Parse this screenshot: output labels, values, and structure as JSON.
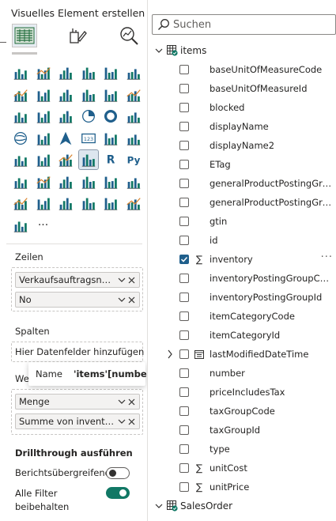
{
  "left_pane": {
    "title": "Visuelles Element erstellen",
    "tabs": [
      {
        "name": "build-visual",
        "icon": "table-grid-icon"
      },
      {
        "name": "format-visual",
        "icon": "paintbrush-icon"
      },
      {
        "name": "analytics",
        "icon": "magnifier-chart-icon"
      }
    ],
    "visual_icons": [
      "stacked-bar-chart",
      "stacked-column-chart",
      "clustered-bar-chart",
      "clustered-column-chart",
      "100-stacked-bar-chart",
      "100-stacked-column-chart",
      "line-chart",
      "area-chart",
      "stacked-area-chart",
      "line-and-column-chart",
      "line-and-clustered-column-chart",
      "ribbon-chart",
      "waterfall-chart",
      "funnel-chart",
      "scatter-chart",
      "pie-chart",
      "donut-chart",
      "treemap",
      "map",
      "filled-map",
      "azure-map",
      "card",
      "multi-row-card",
      "kpi",
      "gauge",
      "slicer",
      "table",
      "matrix",
      "r-script-visual",
      "python-visual",
      "key-influencers",
      "decomposition-tree",
      "qa-visual",
      "smart-narrative",
      "goals",
      "paginated-report",
      "power-apps",
      "power-automate",
      "arcgis-map",
      "shape",
      "chevron",
      "azure-map-layers",
      "text-box",
      "more-visuals"
    ],
    "more_label": "···",
    "zeilen_label": "Zeilen",
    "zeilen_fields": [
      "Verkaufsauftragsnum...",
      "No"
    ],
    "spalten_label": "Spalten",
    "spalten_placeholder": "Hier Datenfelder hinzufügen",
    "werte_label": "We",
    "werte_fields": [
      "Menge",
      "Summe von inventory"
    ],
    "drillthrough_label": "Drillthrough ausführen",
    "cross_report_label": "Berichtsübergreifend",
    "cross_report_on": false,
    "keep_filters_label": "Alle Filter beibehalten",
    "keep_filters_on": true,
    "tooltip": {
      "key": "Name",
      "value": "'items'[number]"
    }
  },
  "right_pane": {
    "search_placeholder": "Suchen",
    "tables": [
      {
        "name": "items",
        "expanded": true,
        "fields": [
          {
            "name": "baseUnitOfMeasureCode",
            "checked": false,
            "type": ""
          },
          {
            "name": "baseUnitOfMeasureId",
            "checked": false,
            "type": ""
          },
          {
            "name": "blocked",
            "checked": false,
            "type": ""
          },
          {
            "name": "displayName",
            "checked": false,
            "type": ""
          },
          {
            "name": "displayName2",
            "checked": false,
            "type": ""
          },
          {
            "name": "ETag",
            "checked": false,
            "type": ""
          },
          {
            "name": "generalProductPostingGroup...",
            "checked": false,
            "type": ""
          },
          {
            "name": "generalProductPostingGroup...",
            "checked": false,
            "type": ""
          },
          {
            "name": "gtin",
            "checked": false,
            "type": ""
          },
          {
            "name": "id",
            "checked": false,
            "type": ""
          },
          {
            "name": "inventory",
            "checked": true,
            "type": "sum",
            "more": "···"
          },
          {
            "name": "inventoryPostingGroupCode",
            "checked": false,
            "type": ""
          },
          {
            "name": "inventoryPostingGroupId",
            "checked": false,
            "type": ""
          },
          {
            "name": "itemCategoryCode",
            "checked": false,
            "type": ""
          },
          {
            "name": "itemCategoryId",
            "checked": false,
            "type": ""
          },
          {
            "name": "lastModifiedDateTime",
            "checked": false,
            "type": "date",
            "expandable": true
          },
          {
            "name": "number",
            "checked": false,
            "type": ""
          },
          {
            "name": "priceIncludesTax",
            "checked": false,
            "type": ""
          },
          {
            "name": "taxGroupCode",
            "checked": false,
            "type": ""
          },
          {
            "name": "taxGroupId",
            "checked": false,
            "type": ""
          },
          {
            "name": "type",
            "checked": false,
            "type": ""
          },
          {
            "name": "unitCost",
            "checked": false,
            "type": "sum"
          },
          {
            "name": "unitPrice",
            "checked": false,
            "type": "sum"
          }
        ]
      },
      {
        "name": "SalesOrder",
        "expanded": true,
        "fields": []
      }
    ],
    "sum_symbol": "∑"
  },
  "colors": {
    "accent_teal": "#117865",
    "check_blue": "#1f5f8c",
    "border": "#c8c6c4"
  }
}
